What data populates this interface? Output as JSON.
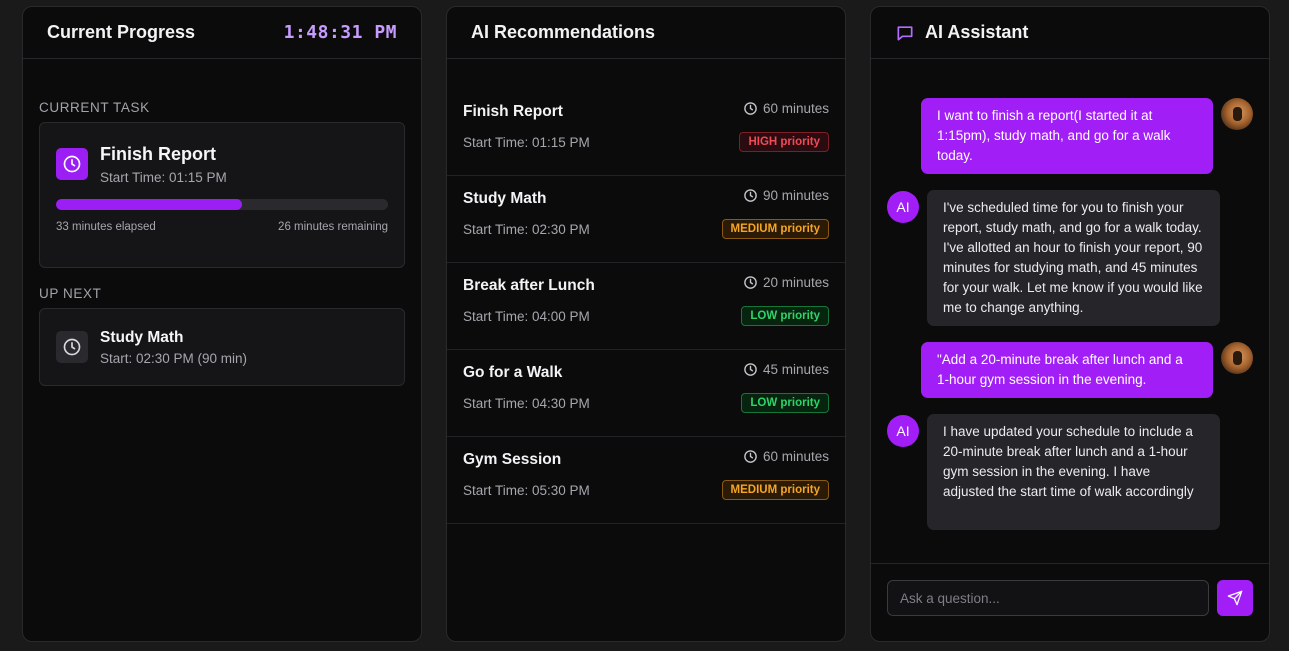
{
  "progress": {
    "title": "Current Progress",
    "clock": "1:48:31 PM",
    "current_task_label": "CURRENT TASK",
    "current_task": {
      "name": "Finish Report",
      "start": "Start Time: 01:15 PM",
      "progress_fraction": 0.56,
      "elapsed": "33 minutes elapsed",
      "remaining": "26 minutes remaining"
    },
    "up_next_label": "UP NEXT",
    "up_next": {
      "name": "Study Math",
      "start": "Start: 02:30 PM (90 min)"
    }
  },
  "recommendations": {
    "title": "AI Recommendations",
    "items": [
      {
        "name": "Finish Report",
        "start": "Start Time: 01:15 PM",
        "duration": "60 minutes",
        "priority": "HIGH priority",
        "level": "high"
      },
      {
        "name": "Study Math",
        "start": "Start Time: 02:30 PM",
        "duration": "90 minutes",
        "priority": "MEDIUM priority",
        "level": "medium"
      },
      {
        "name": "Break after Lunch",
        "start": "Start Time: 04:00 PM",
        "duration": "20 minutes",
        "priority": "LOW priority",
        "level": "low"
      },
      {
        "name": "Go for a Walk",
        "start": "Start Time: 04:30 PM",
        "duration": "45 minutes",
        "priority": "LOW priority",
        "level": "low"
      },
      {
        "name": "Gym Session",
        "start": "Start Time: 05:30 PM",
        "duration": "60 minutes",
        "priority": "MEDIUM priority",
        "level": "medium"
      }
    ]
  },
  "assistant": {
    "title": "AI Assistant",
    "ai_avatar_label": "AI",
    "messages": [
      {
        "role": "user",
        "text": "I want to finish a report(I started it at 1:15pm), study math, and go for a walk today."
      },
      {
        "role": "ai",
        "text": "I've scheduled time for you to finish your report, study math, and go for a walk today. I've allotted an hour to finish your report, 90 minutes for studying math, and 45 minutes for your walk. Let me know if you would like me to change anything."
      },
      {
        "role": "user",
        "text": "\"Add a 20-minute break after lunch and a 1-hour gym session in the evening."
      },
      {
        "role": "ai",
        "text": "I have updated your schedule to include a 20-minute break after lunch and a 1-hour gym session in the evening. I have adjusted the start time of walk accordingly"
      }
    ],
    "input_placeholder": "Ask a question...",
    "input_value": ""
  },
  "colors": {
    "accent": "#9b1ef5",
    "clock": "#c79cff",
    "high": "#f04a57",
    "medium": "#f5a524",
    "low": "#2fd36a"
  }
}
